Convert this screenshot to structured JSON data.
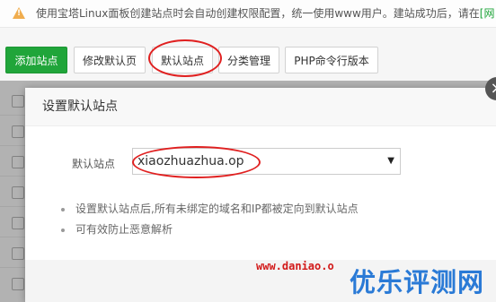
{
  "notice": {
    "text": "使用宝塔Linux面板创建站点时会自动创建权限配置，统一使用www用户。建站成功后，请在",
    "link": "[网"
  },
  "toolbar": {
    "add_site": "添加站点",
    "edit_default_page": "修改默认页",
    "default_site": "默认站点",
    "category_manage": "分类管理",
    "php_cli_version": "PHP命令行版本"
  },
  "modal": {
    "title": "设置默认站点",
    "close": "×",
    "field_label": "默认站点",
    "select_value": "xiaozhuazhua.op",
    "tips": [
      "设置默认站点后,所有未绑定的域名和IP都被定向到默认站点",
      "可有效防止恶意解析"
    ]
  },
  "watermark": {
    "url": "www.daniao.o",
    "brand": "优乐评测网"
  },
  "colors": {
    "primary": "#20a53a",
    "annotation": "#e02020",
    "watermark_url": "#d21a1a",
    "watermark_brand": "#2a7ad6"
  },
  "icons": {
    "warning": "warning-icon",
    "close": "close-icon",
    "dropdown": "caret-down-icon"
  }
}
